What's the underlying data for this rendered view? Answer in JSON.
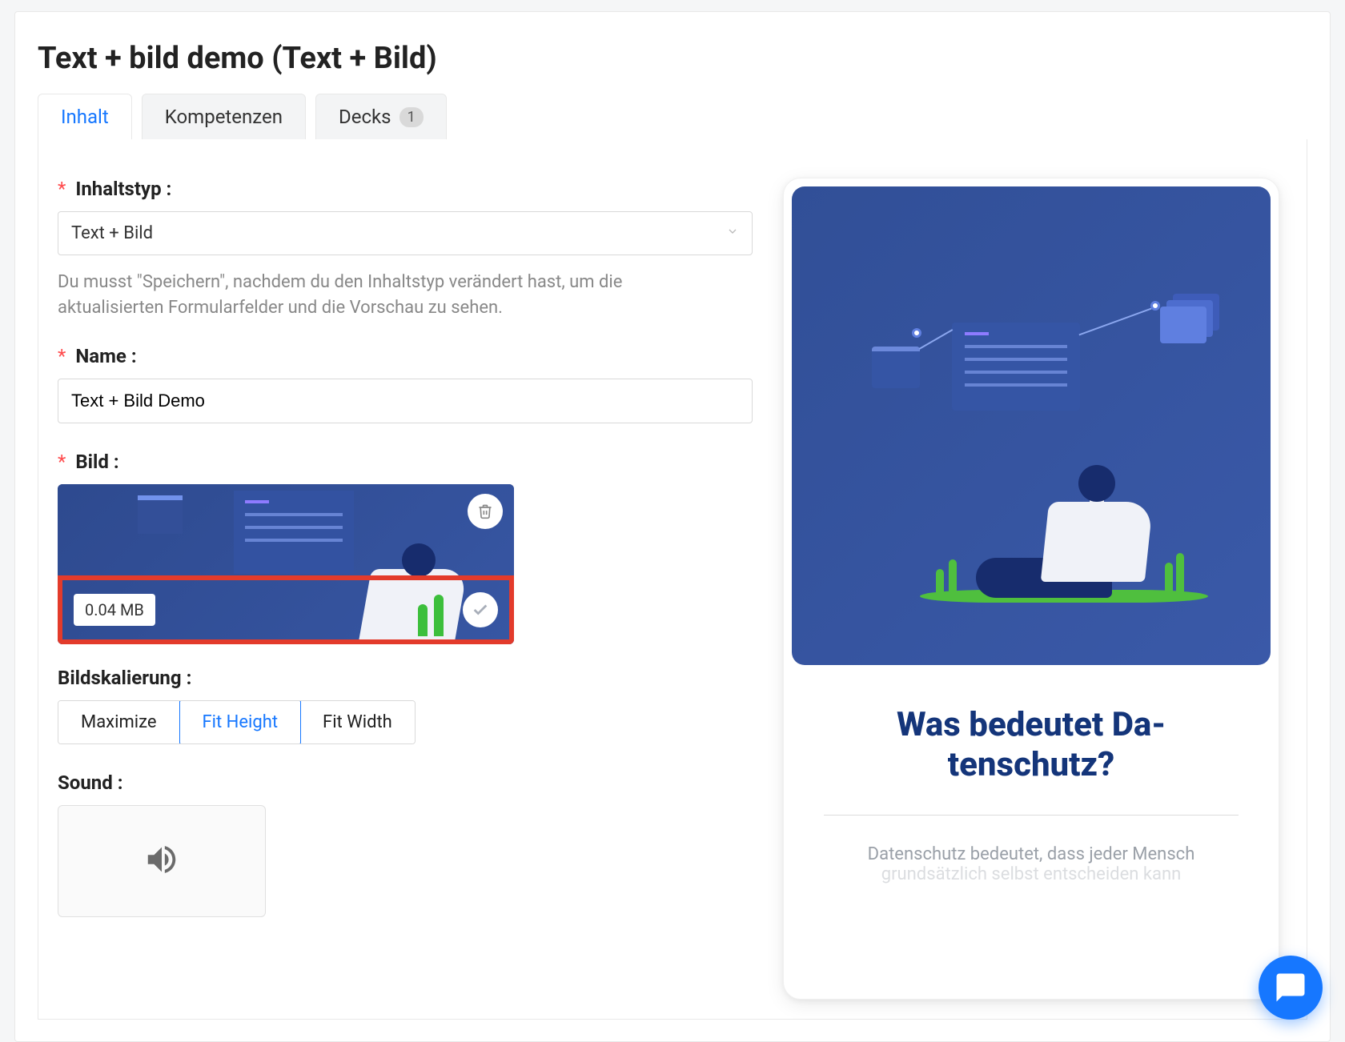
{
  "pageTitle": "Text + bild demo (Text + Bild)",
  "tabs": {
    "inhalt": "Inhalt",
    "kompetenzen": "Kompetenzen",
    "decks": "Decks",
    "decksCount": "1"
  },
  "form": {
    "typeLabel": "Inhaltstyp",
    "typeValue": "Text + Bild",
    "typeHelp": "Du musst \"Speichern\", nachdem du den Inhaltstyp verändert hast, um die aktualisierten Formularfelder und die Vorschau zu sehen.",
    "nameLabel": "Name",
    "nameValue": "Text + Bild Demo",
    "bildLabel": "Bild",
    "fileSize": "0.04 MB",
    "scaleLabel": "Bildskalierung",
    "scaleOptions": {
      "maximize": "Maximize",
      "fitHeight": "Fit Height",
      "fitWidth": "Fit Width"
    },
    "soundLabel": "Sound"
  },
  "preview": {
    "heading": "Was bedeutet Da­tenschutz?",
    "body1": "Datenschutz bedeutet, dass jeder Mensch",
    "body2": "grundsätzlich selbst entscheiden kann"
  }
}
